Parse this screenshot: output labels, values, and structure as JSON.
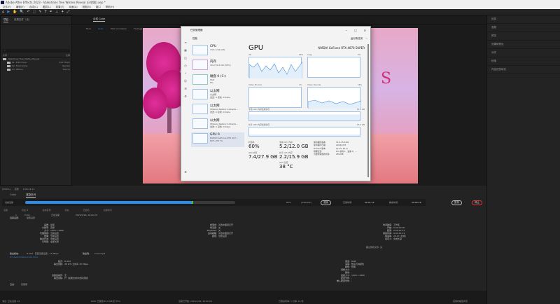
{
  "app": {
    "title": "Adobe After Effects 2023 - Valentines Tree Wishes Reveal (已转换).aep *"
  },
  "menu": [
    "文件(F)",
    "编辑(E)",
    "合成(C)",
    "图层(L)",
    "效果(T)",
    "动画(A)",
    "视图(V)",
    "窗口",
    "帮助(H)"
  ],
  "toolbar": [
    "⌂",
    "▶",
    "✋",
    "🔍",
    "↶",
    "⬚",
    "✎",
    "T",
    "✒",
    "⊥",
    "✦",
    "⤢"
  ],
  "project": {
    "tabs": [
      "项目",
      "效果控件（无）"
    ],
    "search_placeholder": "⌕",
    "col_name": "名称",
    "col_type": "注释",
    "items": [
      {
        "name": "Valentines Tree Wishes Reveal",
        "type": ""
      },
      {
        "name": "01. Edit Comp",
        "type": "Edit Them"
      },
      {
        "name": "02. Final Comp",
        "type": "Render"
      },
      {
        "name": "03. Others",
        "type": "Source"
      }
    ]
  },
  "viewer": {
    "comp_tab": "合成 Color",
    "crumbs": [
      "Final",
      "Color",
      "Wish Animation",
      "Footage",
      "Wish Footage Color (Precomp)"
    ]
  },
  "taskmgr": {
    "title": "任务管理器",
    "section": "性能",
    "run_task": "运行新任务",
    "more": "···",
    "min": "–",
    "max": "☐",
    "close": "✕",
    "list": [
      {
        "name": "CPU",
        "l1": "74% 3.92 GHz",
        "l2": ""
      },
      {
        "name": "内存",
        "l1": "30.2/31.8 GB (95%)",
        "l2": ""
      },
      {
        "name": "磁盘 0 (C:)",
        "l1": "SSD",
        "l2": "5%"
      },
      {
        "name": "以太网",
        "l1": "以太网",
        "l2": "发送: 0 接收: 0 Kbps"
      },
      {
        "name": "以太网",
        "l1": "VMware Network Adapte...",
        "l2": "发送: 0 接收: 0 Kbps"
      },
      {
        "name": "以太网",
        "l1": "VMware Network Adapte...",
        "l2": "发送: 0 接收: 0 Kbps"
      },
      {
        "name": "GPU 0",
        "l1": "NVIDIA GeForce RTX 407...",
        "l2": "60% (38 °C)"
      }
    ],
    "gpu": "GPU",
    "gpu_name": "NVIDIA GeForce RTX 4070 SUPER",
    "engines": [
      {
        "name": "3D",
        "pct": "60%"
      },
      {
        "name": "Copy",
        "pct": "0%"
      },
      {
        "name": "Video Encode",
        "pct": "1%"
      },
      {
        "name": "Video Decode",
        "pct": "16%"
      }
    ],
    "dedicated_label": "专用 GPU 内存使用情况",
    "dedicated_max": "12.0 GB",
    "shared_label": "共享 GPU 内存使用情况",
    "shared_max": "15.9 GB",
    "stats": [
      {
        "k": "利用率",
        "v": "60%"
      },
      {
        "k": "专用 GPU 内存",
        "v": "5.2/12.0 GB"
      },
      {
        "k": "GPU 内存",
        "v": "7.4/27.9 GB"
      },
      {
        "k": "共享 GPU 内存",
        "v": "2.2/15.9 GB"
      },
      {
        "k": "GPU 温度",
        "v": "38 °C"
      }
    ],
    "info": [
      {
        "k": "驱动程序版本:",
        "v": "31.0.15.5161"
      },
      {
        "k": "驱动程序日期:",
        "v": "2024/2/15"
      },
      {
        "k": "DirectX 版本:",
        "v": "12 (FL 12.1)"
      },
      {
        "k": "物理位置:",
        "v": "PCI 总线 1、设备 0、..."
      },
      {
        "k": "为硬件保留的内存:",
        "v": "289 MB"
      }
    ]
  },
  "right": {
    "rows": [
      "信息",
      "音频",
      "预览",
      "效果和预设",
      "对齐",
      "段落",
      "内容识别填充"
    ]
  },
  "timebar": {
    "zoom": "(98.6%)",
    "res": "完整",
    "time": "0:00:14:11"
  },
  "render": {
    "tabs": [
      "Color",
      "渲染队列"
    ],
    "current": "当前渲染",
    "progress": 0.8,
    "pct": "80%",
    "frames": "(349/432)",
    "render_btn": "渲染",
    "elapsed_label": "已用时间:",
    "elapsed": "00:01:14",
    "remain_label": "剩余时间:",
    "remain": "00:00:18",
    "pause": "暂停",
    "stop": "停止",
    "cols": [
      "渲染",
      "标签 #",
      "合成名称",
      "状态",
      "已启动",
      "渲染时间"
    ],
    "row": {
      "num": "1",
      "comp": "Color",
      "status": "正在渲染",
      "started": "2024/1/26, 16:02:24"
    },
    "settings_label": "渲染设置:",
    "settings_val": "最佳设置",
    "log_label": "日志:",
    "log_val": "仅错误",
    "rs_left": [
      [
        "品质:",
        "最佳"
      ],
      [
        "分辨率:",
        "完整"
      ],
      [
        "大小:",
        "1920 x 1080"
      ],
      [
        "代理使用:",
        "当前设置"
      ],
      [
        "效果:",
        "当前设置"
      ],
      [
        "独奏开关:",
        "当前设置"
      ],
      [
        "引导层:",
        "全部关闭"
      ]
    ],
    "rs_mid": [
      [
        "帧混合:",
        "对选中图层打开"
      ],
      [
        "场渲染:",
        "关"
      ],
      [
        "Pulldown:",
        "关"
      ],
      [
        "运动模糊:",
        "对选中图层打开"
      ],
      [
        "颜色:",
        "当前设置"
      ]
    ],
    "rs_right": [
      [
        "时间跨度:",
        "工作区"
      ],
      [
        "开始:",
        "0:00:00:00"
      ],
      [
        "结束:",
        "0:00:14:11"
      ],
      [
        "持续时间:",
        "0:00:14:12"
      ],
      [
        "帧速率:",
        "29.97 (合成)"
      ],
      [
        "自定义:",
        "合成长度"
      ]
    ],
    "skip": "跳过现有文件: 关",
    "om_label": "输出模块:",
    "om_val": "H.264 - 匹配渲染设置 - 15 Mbps",
    "out_label": "输出到:",
    "out_val": "Color.mp4",
    "path": "D:\\Users\\Videos\\Color.mp4",
    "om_left": [
      [
        "格式:",
        "H.264"
      ],
      [
        "输出音频:",
        "48 kHz 立体声 15 Mbps"
      ]
    ],
    "om_post": [
      [
        "渲染后动作:",
        "无"
      ],
      [
        "输出音频:",
        "开（如果合成中含有音频）"
      ]
    ],
    "om_right": [
      [
        "通道:",
        "RGB"
      ],
      [
        "深度:",
        "数百万种颜色"
      ],
      [
        "颜色:",
        "预乘"
      ],
      [
        "调整大小:",
        "-"
      ],
      [
        "裁剪:",
        "-"
      ],
      [
        "最终大小:",
        "1920 x 1080"
      ],
      [
        "配置文件:",
        "-"
      ],
      [
        "嵌入配置文件:",
        "-"
      ]
    ]
  },
  "status": {
    "msg": "消息: 正在渲染 1/1",
    "ram": "RAM: 已使用 31.6 GB 的 75%",
    "start": "渲染已开始: 2024/1/26, 16:02:24",
    "total": "已用总时间: 1 分钟, 14 秒",
    "sound": "完成时播放声音"
  }
}
